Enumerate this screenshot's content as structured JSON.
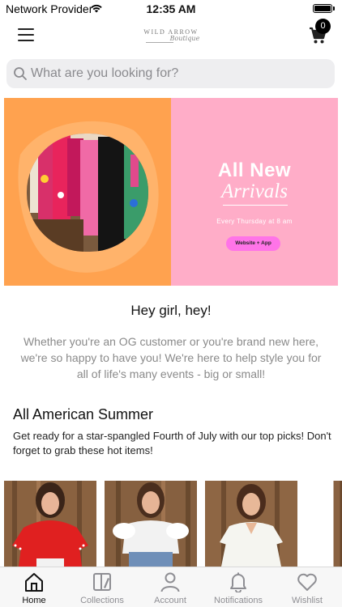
{
  "status_bar": {
    "carrier": "Network Provider",
    "time": "12:35 AM"
  },
  "header": {
    "logo_main": "WILD ARROW",
    "logo_script": "Boutique",
    "cart_count": "0"
  },
  "search": {
    "placeholder": "What are you looking for?"
  },
  "banner": {
    "headline": "All New",
    "script": "Arrivals",
    "subtext": "Every Thursday at 8 am",
    "cta": "Website + App",
    "colors": {
      "left": "#ffa24f",
      "right": "#ffadc8",
      "cta": "#ff74e8"
    }
  },
  "welcome": {
    "title": "Hey girl, hey!",
    "text": "Whether you're an OG customer or you're brand new here, we're so happy to have you! We're here to help style you for all of life's many events - big or small!"
  },
  "section": {
    "title": "All American Summer",
    "description": "Get ready for a star-spangled Fourth of July with our top picks! Don't forget to grab these hot items!"
  },
  "products": [
    {
      "name": "red-top-product",
      "top_color": "#e02020"
    },
    {
      "name": "white-ruffle-top-product",
      "top_color": "#f2f2f2"
    },
    {
      "name": "white-dress-product",
      "top_color": "#f5f5f0"
    },
    {
      "name": "blue-top-product",
      "top_color": "#2f5fa8"
    }
  ],
  "tabs": [
    {
      "label": "Home",
      "icon": "home-icon",
      "active": true
    },
    {
      "label": "Collections",
      "icon": "collections-icon",
      "active": false
    },
    {
      "label": "Account",
      "icon": "account-icon",
      "active": false
    },
    {
      "label": "Notifications",
      "icon": "bell-icon",
      "active": false
    },
    {
      "label": "Wishlist",
      "icon": "heart-icon",
      "active": false
    }
  ]
}
